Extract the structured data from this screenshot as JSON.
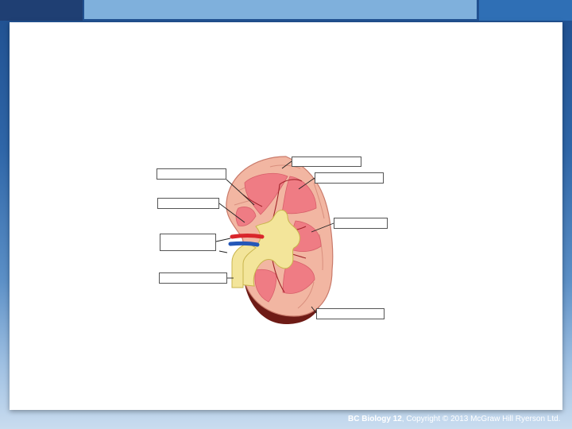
{
  "footer": {
    "book_title": "BC Biology 12",
    "copyright": ", Copyright © 2013 McGraw Hill Ryerson Ltd."
  },
  "diagram": {
    "subject": "kidney cross-section",
    "label_boxes": 8,
    "colors": {
      "cortex": "#f2b7a3",
      "medulla": "#f07f86",
      "pelvis": "#f3e59a",
      "artery": "#d9262b",
      "vein": "#2457b8",
      "capsule_dark": "#7a1f1a"
    }
  }
}
